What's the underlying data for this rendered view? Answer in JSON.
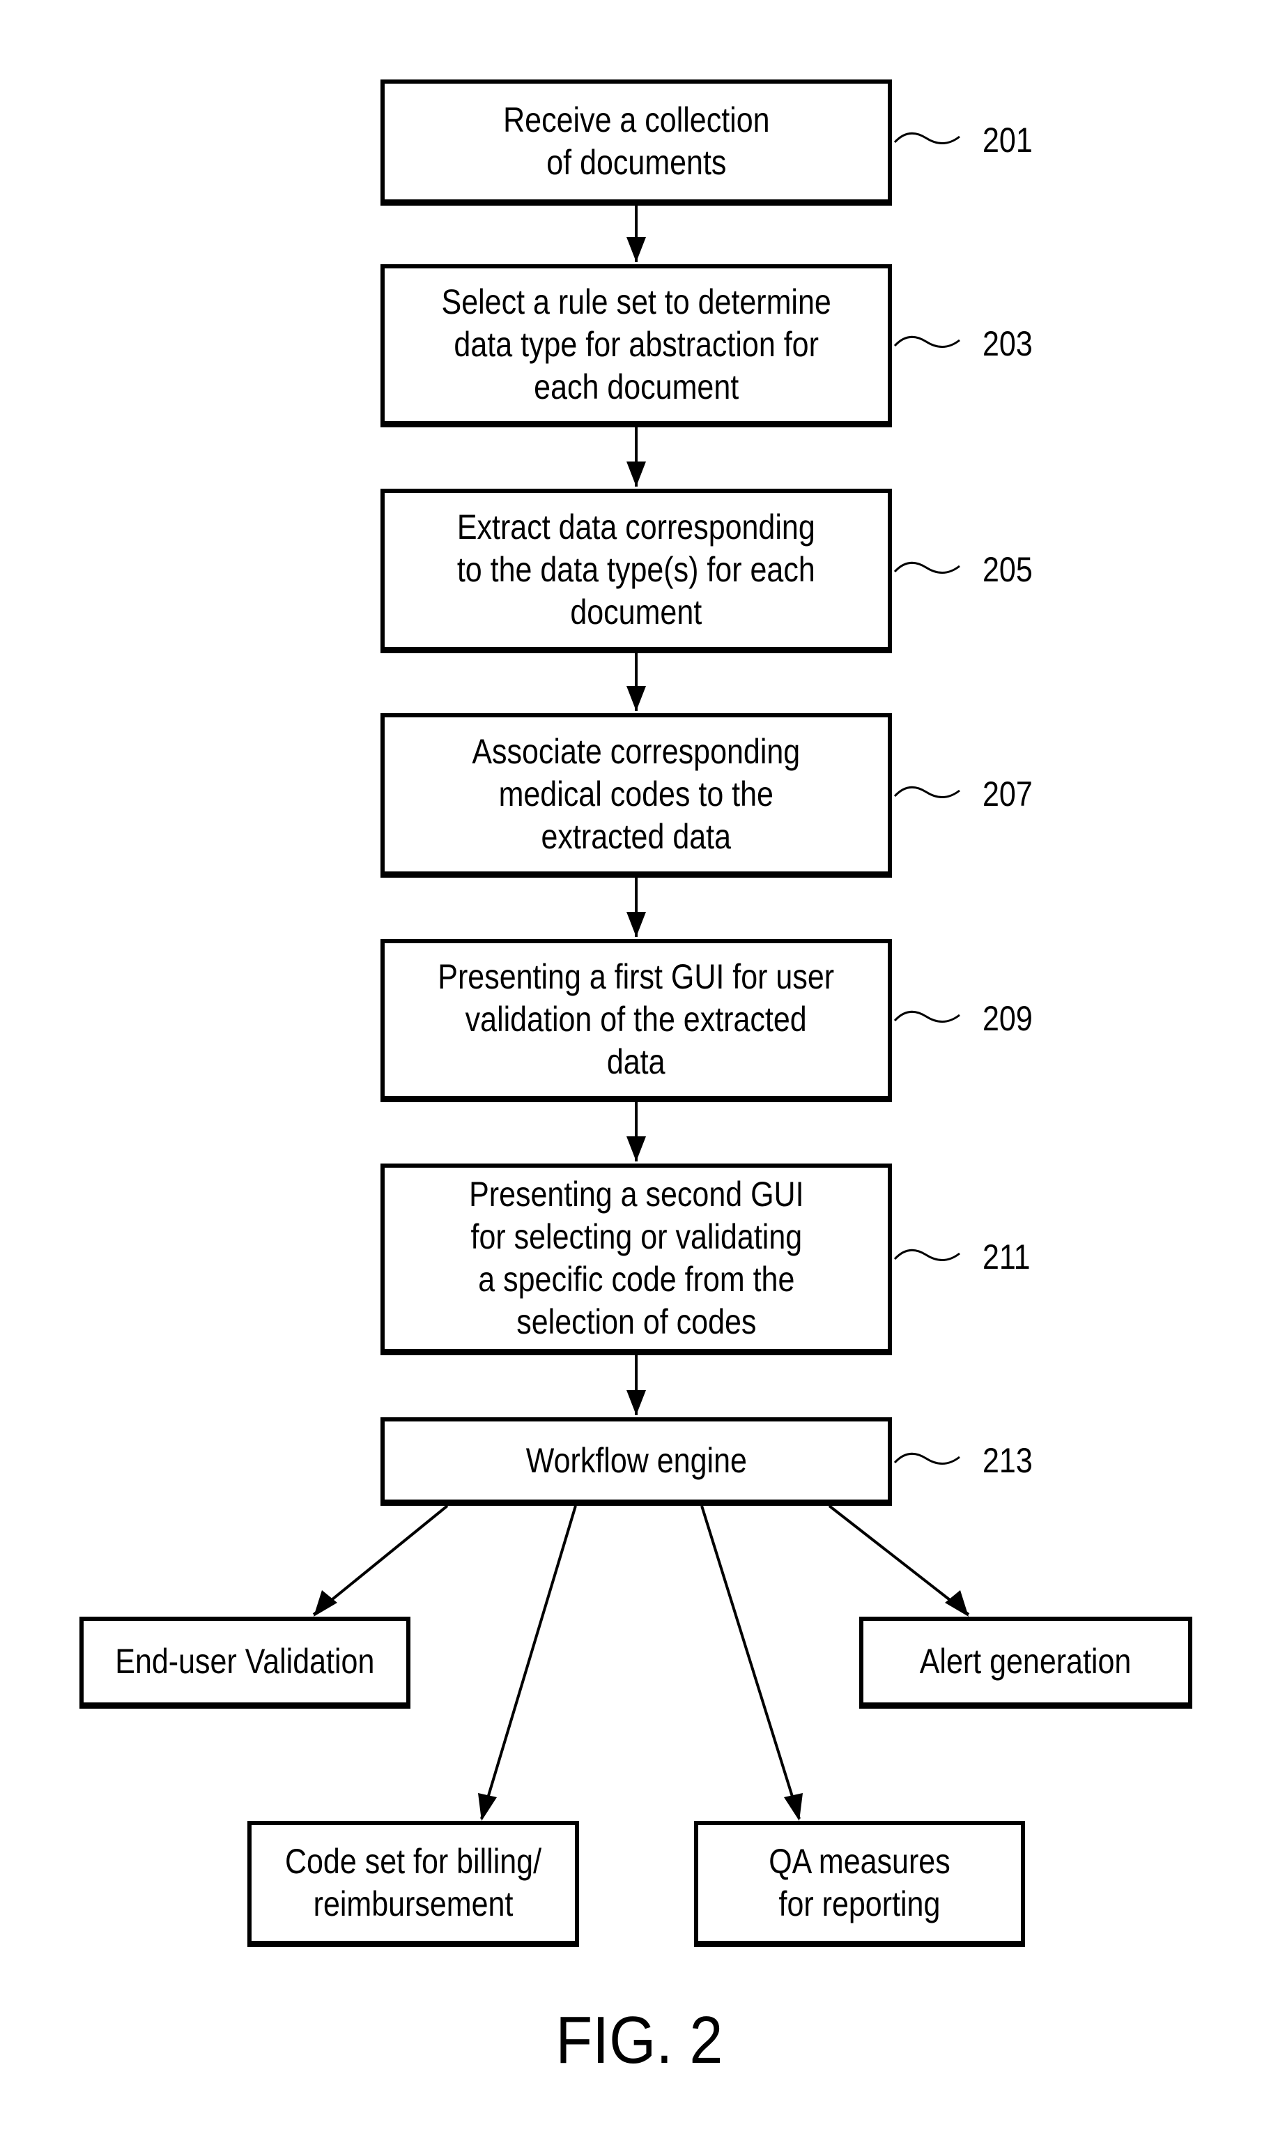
{
  "steps": [
    {
      "id": "201",
      "text": "Receive a collection\nof documents"
    },
    {
      "id": "203",
      "text": "Select a rule set to determine\ndata type for abstraction for\neach document"
    },
    {
      "id": "205",
      "text": "Extract data corresponding\nto the data type(s) for each\ndocument"
    },
    {
      "id": "207",
      "text": "Associate corresponding\nmedical codes to the\nextracted data"
    },
    {
      "id": "209",
      "text": "Presenting a first GUI for user\nvalidation of the extracted\ndata"
    },
    {
      "id": "211",
      "text": "Presenting a second GUI\nfor selecting or validating\na specific code from the\nselection of codes"
    },
    {
      "id": "213",
      "text": "Workflow engine"
    }
  ],
  "outputs": [
    {
      "text": "End-user Validation"
    },
    {
      "text": "Alert generation"
    },
    {
      "text": "Code set for billing/\nreimbursement"
    },
    {
      "text": "QA measures\nfor reporting"
    }
  ],
  "caption": "FIG. 2"
}
